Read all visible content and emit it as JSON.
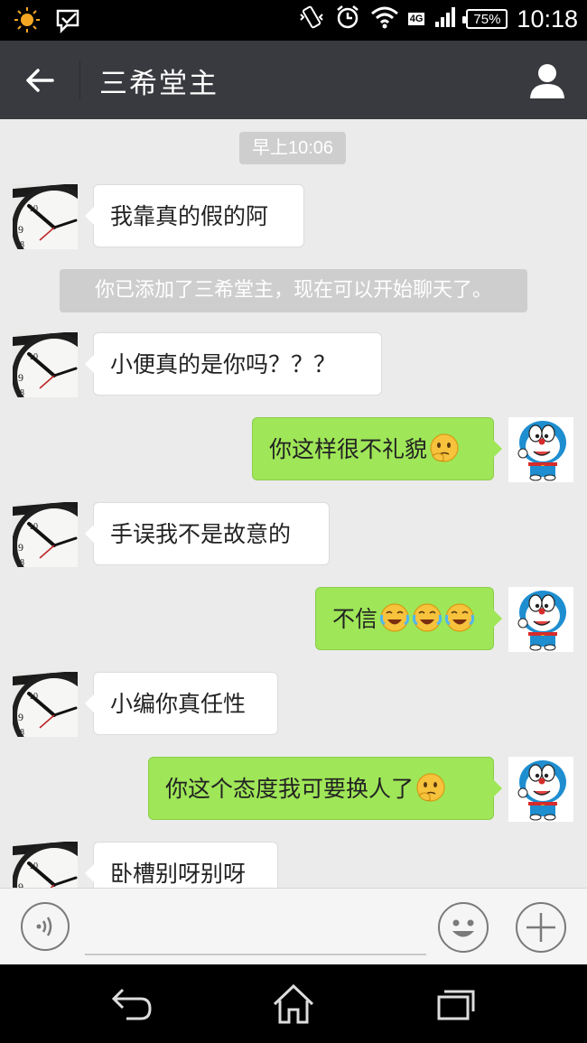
{
  "status_bar": {
    "time": "10:18",
    "battery": "75%",
    "network": "4G",
    "icons": [
      "weather-sun-icon",
      "message-notification-icon",
      "vibrate-icon",
      "alarm-icon",
      "wifi-icon",
      "network-4g-icon",
      "signal-icon",
      "battery-icon"
    ]
  },
  "header": {
    "title": "三希堂主",
    "back_icon": "back-arrow-icon",
    "profile_icon": "profile-icon"
  },
  "chat": {
    "timestamp": "早上10:06",
    "system_message": "你已添加了三希堂主，现在可以开始聊天了。",
    "messages": [
      {
        "side": "in",
        "text": "我靠真的假的阿"
      },
      {
        "side": "in",
        "text": "小便真的是你吗？？？"
      },
      {
        "side": "out",
        "text": "你这样很不礼貌",
        "emoji": "thinking-emoji"
      },
      {
        "side": "in",
        "text": "手误我不是故意的"
      },
      {
        "side": "out",
        "text": "不信",
        "emoji": "crying-laughing-emoji x3"
      },
      {
        "side": "in",
        "text": "小编你真任性"
      },
      {
        "side": "out",
        "text": "你这个态度我可要换人了",
        "emoji": "thinking-emoji"
      },
      {
        "side": "in",
        "text": "卧槽别呀别呀"
      }
    ],
    "avatars": {
      "in": "clock-avatar",
      "out": "doraemon-avatar"
    }
  },
  "input_bar": {
    "placeholder": "",
    "voice_icon": "voice-icon",
    "emoji_icon": "emoji-icon",
    "plus_icon": "plus-icon"
  },
  "nav_bar": {
    "icons": [
      "nav-back-icon",
      "nav-home-icon",
      "nav-recent-icon"
    ]
  }
}
